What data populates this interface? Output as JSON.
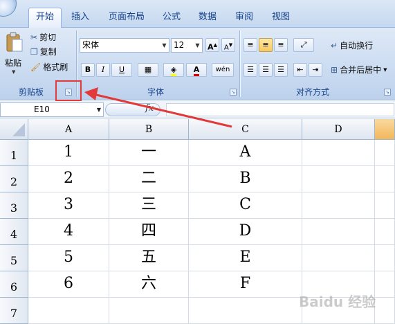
{
  "ribbon": {
    "tabs": [
      "开始",
      "插入",
      "页面布局",
      "公式",
      "数据",
      "审阅",
      "视图"
    ],
    "active_tab": "开始",
    "clipboard": {
      "paste": "粘贴",
      "cut": "剪切",
      "copy": "复制",
      "format_painter": "格式刷",
      "label": "剪贴板"
    },
    "font": {
      "name": "宋体",
      "size": "12",
      "bold": "B",
      "italic": "I",
      "underline": "U",
      "label": "字体"
    },
    "alignment": {
      "wrap_text": "自动换行",
      "merge_center": "合并后居中",
      "label": "对齐方式"
    }
  },
  "formula_bar": {
    "name_box": "E10",
    "fx": "fx",
    "formula": ""
  },
  "sheet": {
    "columns": [
      "A",
      "B",
      "C",
      "D"
    ],
    "rows": [
      "1",
      "2",
      "3",
      "4",
      "5",
      "6",
      "7"
    ],
    "cells": [
      [
        "1",
        "一",
        "A",
        ""
      ],
      [
        "2",
        "二",
        "B",
        ""
      ],
      [
        "3",
        "三",
        "C",
        ""
      ],
      [
        "4",
        "四",
        "D",
        ""
      ],
      [
        "5",
        "五",
        "E",
        ""
      ],
      [
        "6",
        "六",
        "F",
        ""
      ],
      [
        "",
        "",
        "",
        ""
      ]
    ]
  },
  "watermark": "Baidu 经验",
  "colors": {
    "highlight": "#e23a3a",
    "selected_col": "#f3b75c"
  }
}
